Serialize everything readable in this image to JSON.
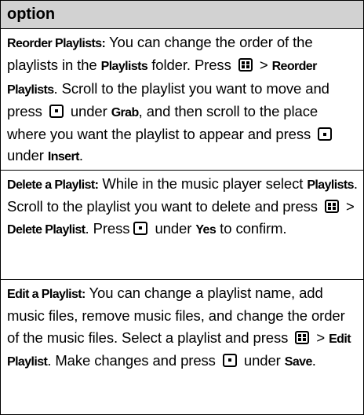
{
  "header": {
    "title": "option"
  },
  "rows": {
    "reorder": {
      "label": "Reorder Playlists:",
      "t1": " You can change the order of the playlists in the ",
      "b1": "Playlists",
      "t2": " folder. Press ",
      "sep1": " > ",
      "b2": "Reorder Playlists",
      "t3": ". Scroll to the playlist you want to move and press ",
      "t4": " under ",
      "b3": "Grab",
      "t5": ", and then scroll to the place where you want the playlist to appear and press ",
      "t6": "under ",
      "b4": "Insert",
      "t7": "."
    },
    "delete": {
      "label": "Delete a Playlist:",
      "t1": " While in the music player select ",
      "b1": "Playlists",
      "t2": ". Scroll to the playlist you want to delete and press ",
      "sep1": " > ",
      "b2": "Delete Playlist",
      "t3": ". Press ",
      "t4": " under ",
      "b3": "Yes",
      "t5": " to confirm."
    },
    "edit": {
      "label": "Edit a Playlist:",
      "t1": " You can change a playlist name, add music files, remove music files, and change the order of the music files. Select a playlist and press ",
      "sep1": " > ",
      "b1": "Edit Playlist",
      "t2": ". Make changes and press ",
      "t3": " under ",
      "b2": "Save",
      "t4": "."
    }
  },
  "icons": {
    "menu_key": "menu-key-icon",
    "center_key": "center-select-key-icon"
  }
}
